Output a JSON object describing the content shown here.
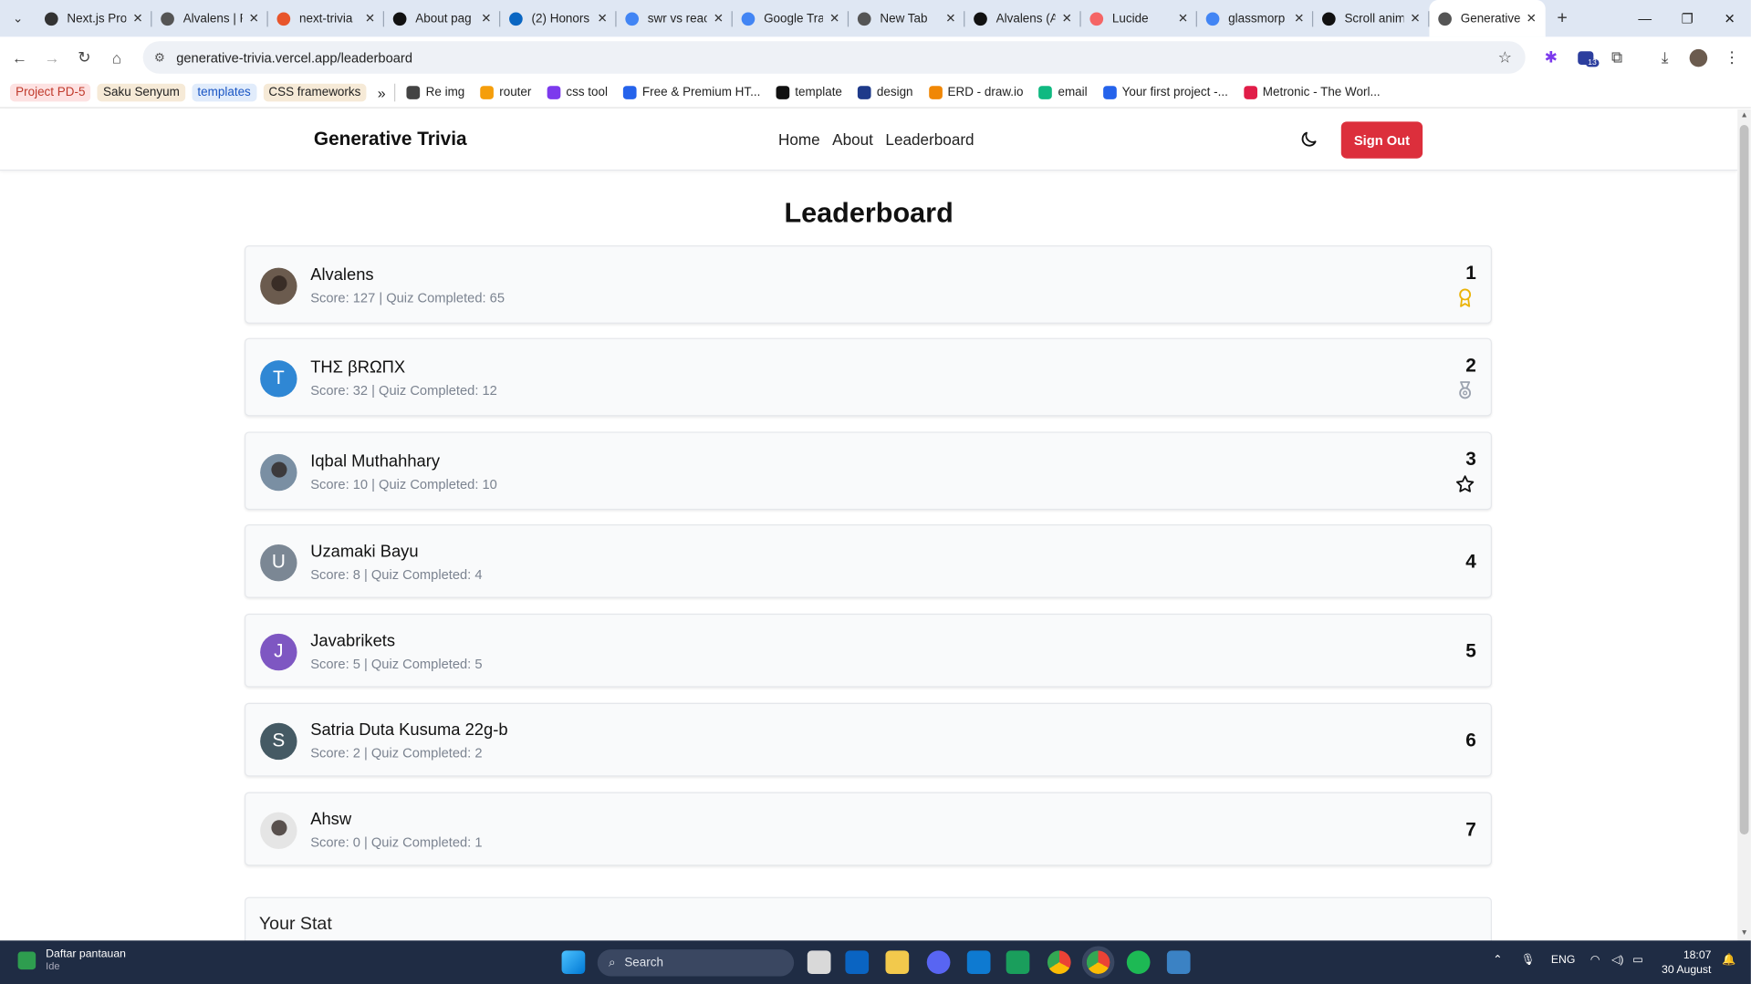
{
  "browser": {
    "tabs": [
      {
        "title": "Next.js Pro",
        "color": "#333333"
      },
      {
        "title": "Alvalens | F",
        "color": "#555555"
      },
      {
        "title": "next-trivia",
        "color": "#e8552b"
      },
      {
        "title": "About pag",
        "color": "#111111"
      },
      {
        "title": "(2) Honors",
        "color": "#0a66c2"
      },
      {
        "title": "swr vs reac",
        "color": "#4285f4"
      },
      {
        "title": "Google Tra",
        "color": "#4285f4"
      },
      {
        "title": "New Tab",
        "color": "#555555"
      },
      {
        "title": "Alvalens (A",
        "color": "#111111"
      },
      {
        "title": "Lucide",
        "color": "#f56565"
      },
      {
        "title": "glassmorp",
        "color": "#4285f4"
      },
      {
        "title": "Scroll anim",
        "color": "#111111"
      },
      {
        "title": "Generative",
        "color": "#555555"
      }
    ],
    "url": "generative-trivia.vercel.app/leaderboard",
    "bookmarks_chips": [
      {
        "label": "Project PD-5",
        "bg": "#fde2e2",
        "fg": "#c0392b"
      },
      {
        "label": "Saku Senyum",
        "bg": "#f6ead7",
        "fg": "#222222"
      },
      {
        "label": "templates",
        "bg": "#e1ecfb",
        "fg": "#1a56c4"
      },
      {
        "label": "CSS frameworks",
        "bg": "#f6ead7",
        "fg": "#222222"
      }
    ],
    "bookmarks_more": "»",
    "bookmarks": [
      {
        "label": "Re img",
        "color": "#444444"
      },
      {
        "label": "router",
        "color": "#f59e0b"
      },
      {
        "label": "css tool",
        "color": "#7c3aed"
      },
      {
        "label": "Free & Premium HT...",
        "color": "#2563eb"
      },
      {
        "label": "template",
        "color": "#111111"
      },
      {
        "label": "design",
        "color": "#1e3a8a"
      },
      {
        "label": "ERD - draw.io",
        "color": "#f08705"
      },
      {
        "label": "email",
        "color": "#10b981"
      },
      {
        "label": "Your first project -...",
        "color": "#2563eb"
      },
      {
        "label": "Metronic - The Worl...",
        "color": "#e11d48"
      }
    ],
    "extension_badge": "13"
  },
  "site": {
    "brand": "Generative Trivia",
    "nav": [
      "Home",
      "About",
      "Leaderboard"
    ],
    "sign_out": "Sign Out",
    "page_title": "Leaderboard",
    "leaderboard": [
      {
        "name": "Alvalens",
        "stats": "Score: 127 | Quiz Completed: 65",
        "rank": "1",
        "avatar": "photo",
        "avatar_color": "#6b5b4e",
        "icon": "award-icon",
        "icon_color": "#eab308"
      },
      {
        "name": "ΤΗΣ βRΩΠΧ",
        "stats": "Score: 32 | Quiz Completed: 12",
        "rank": "2",
        "avatar": "T",
        "avatar_color": "#2f87d4",
        "icon": "medal-icon",
        "icon_color": "#9ca3af"
      },
      {
        "name": "Iqbal Muthahhary",
        "stats": "Score: 10 | Quiz Completed: 10",
        "rank": "3",
        "avatar": "photo",
        "avatar_color": "#7a8fa3",
        "icon": "star-icon",
        "icon_color": "#111111"
      },
      {
        "name": "Uzamaki Bayu",
        "stats": "Score: 8 | Quiz Completed: 4",
        "rank": "4",
        "avatar": "U",
        "avatar_color": "#7b8794",
        "icon": "",
        "icon_color": ""
      },
      {
        "name": "Javabrikets",
        "stats": "Score: 5 | Quiz Completed: 5",
        "rank": "5",
        "avatar": "J",
        "avatar_color": "#7e57c2",
        "icon": "",
        "icon_color": ""
      },
      {
        "name": "Satria Duta Kusuma 22g-b",
        "stats": "Score: 2 | Quiz Completed: 2",
        "rank": "6",
        "avatar": "S",
        "avatar_color": "#455a64",
        "icon": "",
        "icon_color": ""
      },
      {
        "name": "Ahsw",
        "stats": "Score: 0 | Quiz Completed: 1",
        "rank": "7",
        "avatar": "photo",
        "avatar_color": "#e5e5e5",
        "icon": "",
        "icon_color": ""
      }
    ],
    "your_stat_title": "Your Stat"
  },
  "taskbar": {
    "watchlist_title": "Daftar pantauan",
    "watchlist_sub": "Ide",
    "search_placeholder": "Search",
    "language": "ENG",
    "time": "18:07",
    "date": "30 August"
  }
}
